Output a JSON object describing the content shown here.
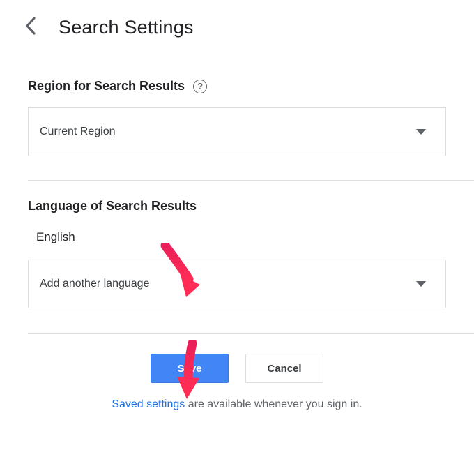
{
  "header": {
    "title": "Search Settings"
  },
  "region_section": {
    "title": "Region for Search Results",
    "help_tooltip": "?",
    "dropdown_value": "Current Region"
  },
  "language_section": {
    "title": "Language of Search Results",
    "current_language": "English",
    "dropdown_value": "Add another language"
  },
  "buttons": {
    "save": "Save",
    "cancel": "Cancel"
  },
  "footer": {
    "link_text": "Saved settings",
    "rest_text": " are available whenever you sign in."
  }
}
